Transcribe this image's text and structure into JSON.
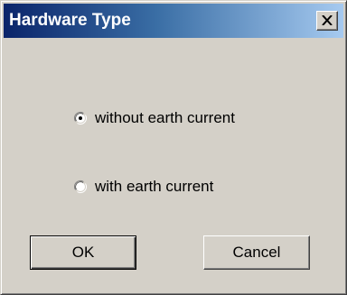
{
  "window": {
    "title": "Hardware Type",
    "close_icon": "close-x-icon"
  },
  "options": [
    {
      "label": "without earth current",
      "selected": true
    },
    {
      "label": "with earth current",
      "selected": false
    }
  ],
  "buttons": {
    "ok_label": "OK",
    "cancel_label": "Cancel"
  },
  "colors": {
    "face": "#d4d0c8",
    "title_start": "#0a246a",
    "title_end": "#a6caf0",
    "title_text": "#ffffff"
  }
}
